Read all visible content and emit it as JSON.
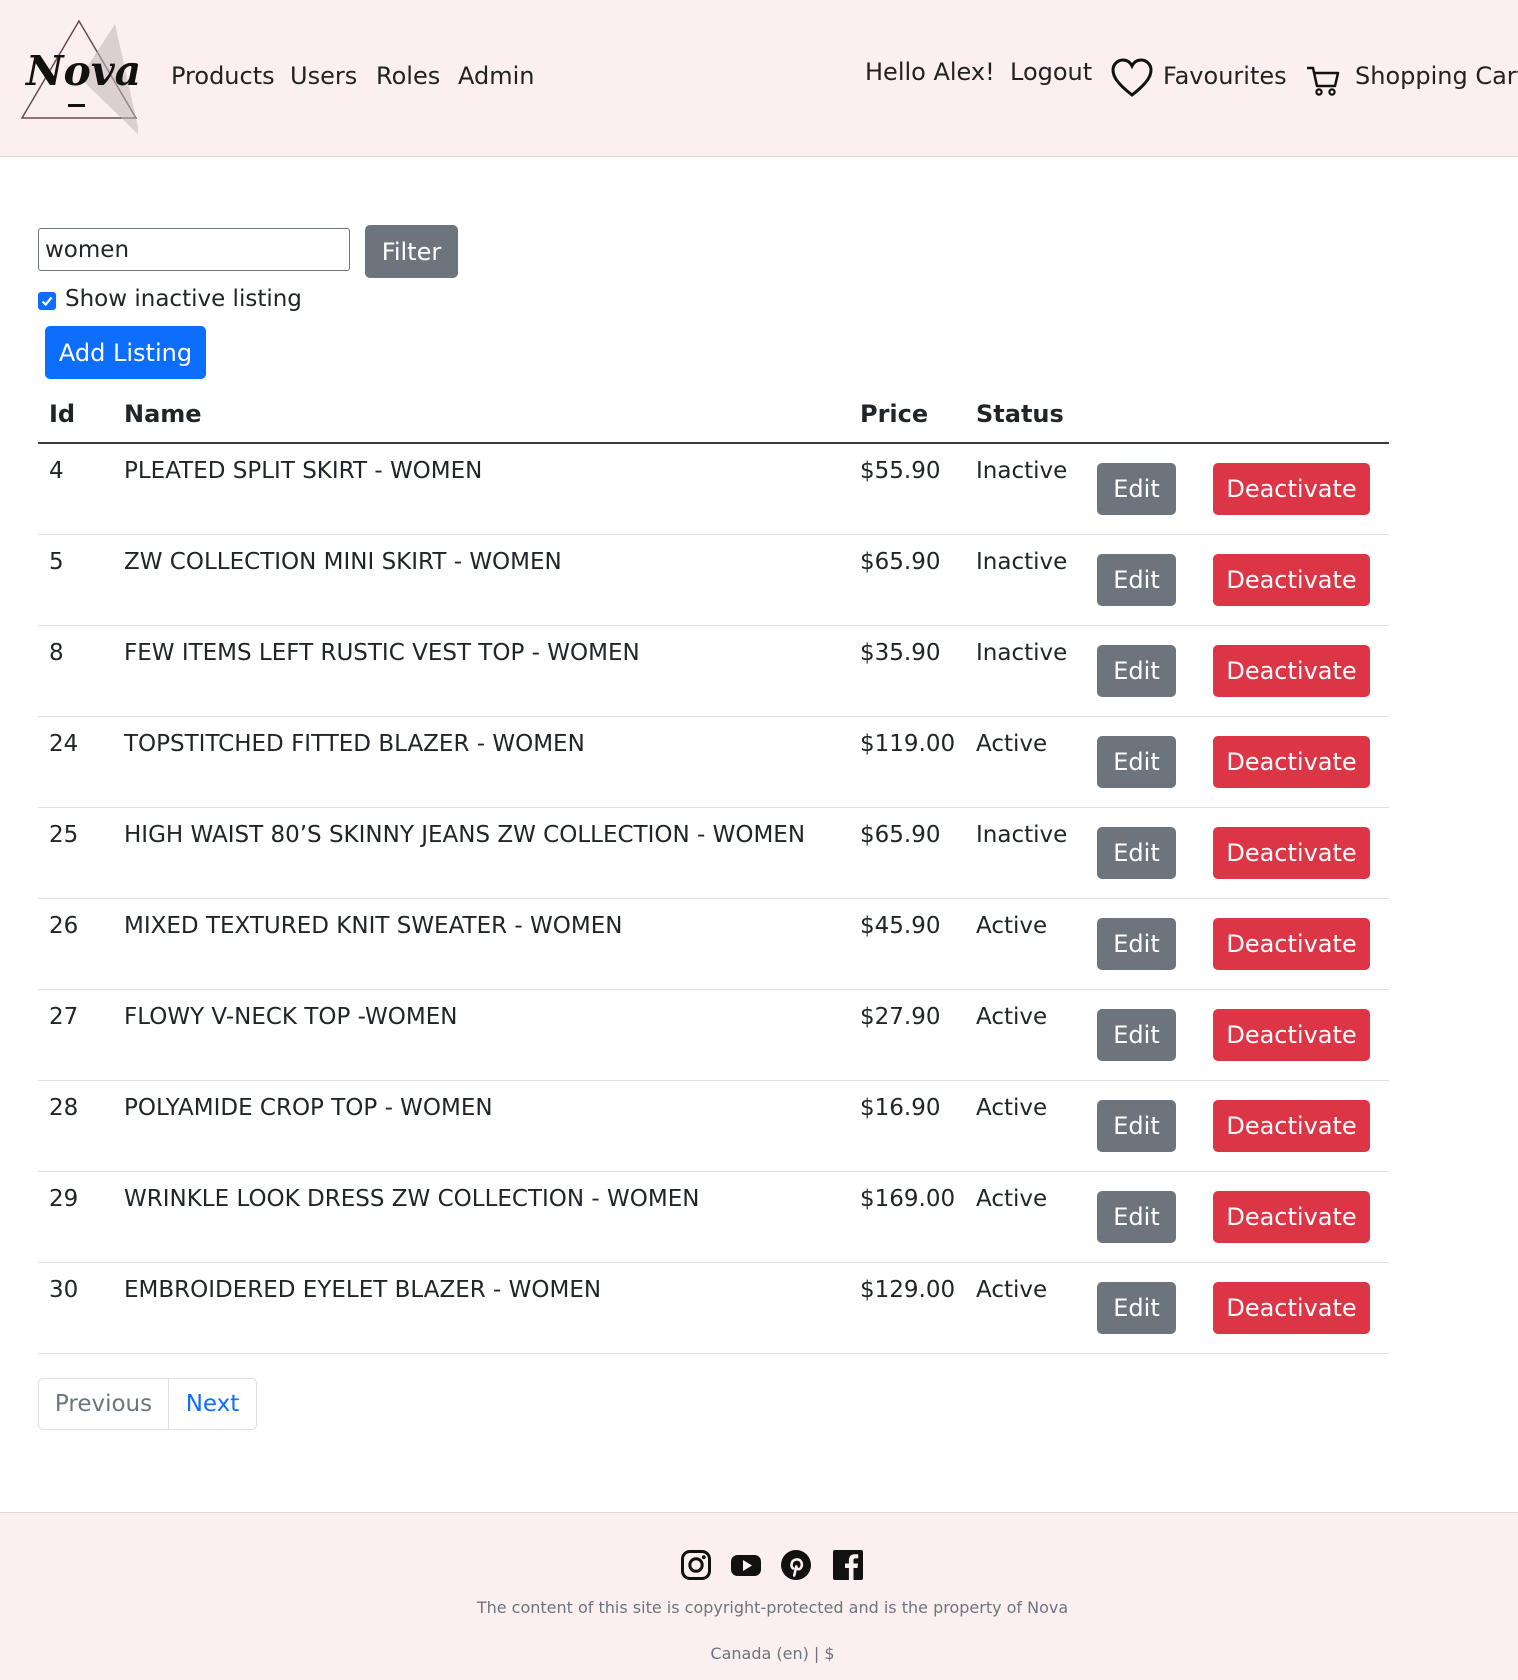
{
  "header": {
    "logo_text": "Nova",
    "nav": [
      "Products",
      "Users",
      "Roles",
      "Admin"
    ],
    "greeting": "Hello Alex!",
    "logout": "Logout",
    "favourites": "Favourites",
    "cart": "Shopping Cart"
  },
  "filter": {
    "value": "women",
    "button": "Filter",
    "show_inactive_label": "Show inactive listing",
    "show_inactive_checked": true
  },
  "add_listing": "Add Listing",
  "table": {
    "headers": {
      "id": "Id",
      "name": "Name",
      "price": "Price",
      "status": "Status"
    },
    "edit_label": "Edit",
    "deactivate_label": "Deactivate",
    "rows": [
      {
        "id": "4",
        "name": "PLEATED SPLIT SKIRT - WOMEN",
        "price": "$55.90",
        "status": "Inactive"
      },
      {
        "id": "5",
        "name": "ZW COLLECTION MINI SKIRT - WOMEN",
        "price": "$65.90",
        "status": "Inactive"
      },
      {
        "id": "8",
        "name": "FEW ITEMS LEFT RUSTIC VEST TOP - WOMEN",
        "price": "$35.90",
        "status": "Inactive"
      },
      {
        "id": "24",
        "name": "TOPSTITCHED FITTED BLAZER - WOMEN",
        "price": "$119.00",
        "status": "Active"
      },
      {
        "id": "25",
        "name": "HIGH WAIST 80’S SKINNY JEANS ZW COLLECTION - WOMEN",
        "price": "$65.90",
        "status": "Inactive"
      },
      {
        "id": "26",
        "name": "MIXED TEXTURED KNIT SWEATER - WOMEN",
        "price": "$45.90",
        "status": "Active"
      },
      {
        "id": "27",
        "name": "FLOWY V-NECK TOP -WOMEN",
        "price": "$27.90",
        "status": "Active"
      },
      {
        "id": "28",
        "name": "POLYAMIDE CROP TOP - WOMEN",
        "price": "$16.90",
        "status": "Active"
      },
      {
        "id": "29",
        "name": "WRINKLE LOOK DRESS ZW COLLECTION - WOMEN",
        "price": "$169.00",
        "status": "Active"
      },
      {
        "id": "30",
        "name": "EMBROIDERED EYELET BLAZER - WOMEN",
        "price": "$129.00",
        "status": "Active"
      }
    ]
  },
  "pagination": {
    "previous": "Previous",
    "next": "Next"
  },
  "footer": {
    "social_icons": [
      "instagram-icon",
      "youtube-icon",
      "pinterest-icon",
      "facebook-icon"
    ],
    "copyright": "The content of this site is copyright-protected and is the property of Nova",
    "locale": "Canada (en) | $"
  },
  "colors": {
    "header_bg": "#fcefef",
    "primary": "#0d6efd",
    "secondary": "#6c757d",
    "danger": "#dc3545"
  }
}
